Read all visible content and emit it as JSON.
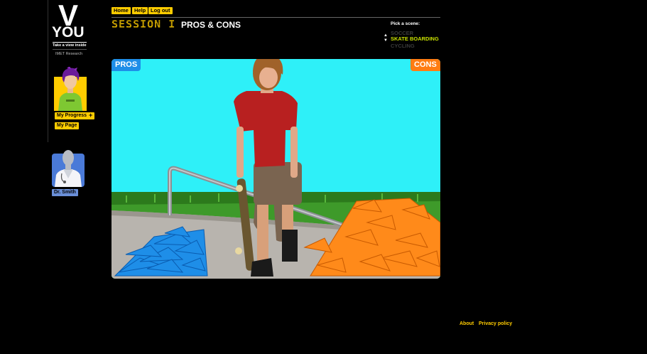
{
  "logo": {
    "letter": "V",
    "word": "YOU",
    "tagline": "Take a view inside",
    "org": "IMET Research"
  },
  "user": {
    "progress_label": "My Progress",
    "progress_plus": "+",
    "mypage_label": "My Page"
  },
  "doctor": {
    "label": "Dr. Smith"
  },
  "nav": {
    "home": "Home",
    "help": "Help",
    "logout": "Log out"
  },
  "session": {
    "label": "SESSION I",
    "title": "PROS & CONS"
  },
  "scene_picker": {
    "label": "Pick a scene:",
    "arrows": "▲\n▼",
    "options": [
      "SOCCER",
      "SKATE BOARDING",
      "CYCLING"
    ],
    "selected": "SKATE BOARDING"
  },
  "stage": {
    "pros_label": "PROS",
    "cons_label": "CONS"
  },
  "colors": {
    "accent": "#ffcc00",
    "pros": "#1e8ee8",
    "cons": "#ff7c12",
    "sky": "#2ef0f8",
    "selected_scene": "#c8e000"
  },
  "footer": {
    "about": "About",
    "privacy": "Privacy policy"
  }
}
